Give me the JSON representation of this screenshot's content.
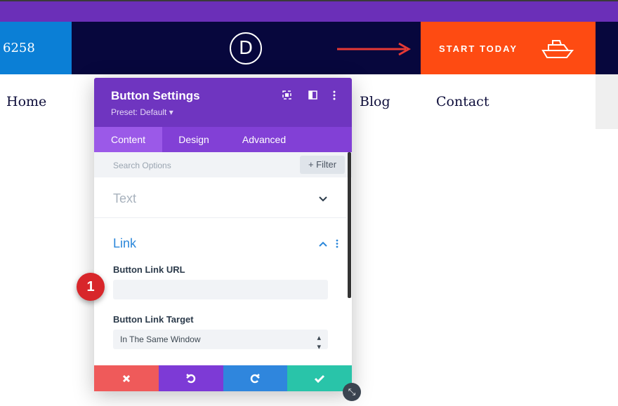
{
  "header": {
    "phone_partial": "6258",
    "logo_letter": "D",
    "cta_label": "START TODAY",
    "cta_icon": "boat-icon",
    "colors": {
      "top_strip": "#6b2fb8",
      "header": "#07073d",
      "phone_box": "#0b7fd6",
      "cta": "#fe4b12",
      "arrow": "#e53935"
    }
  },
  "nav": {
    "items": [
      "Home",
      "Blog",
      "Contact"
    ]
  },
  "modal": {
    "title": "Button Settings",
    "preset": "Preset: Default ▾",
    "header_icons": [
      "fullscreen-icon",
      "sidebar-icon",
      "more-icon"
    ],
    "tabs": [
      "Content",
      "Design",
      "Advanced"
    ],
    "active_tab": "Content",
    "search_placeholder": "Search Options",
    "filter_label": "+ Filter",
    "sections": {
      "text_title": "Text",
      "link_title": "Link"
    },
    "fields": {
      "url_label": "Button Link URL",
      "url_value": "",
      "target_label": "Button Link Target",
      "target_value": "In The Same Window"
    },
    "footer_buttons": [
      "cancel-icon",
      "undo-icon",
      "redo-icon",
      "save-icon"
    ],
    "colors": {
      "head": "#6f35c0",
      "tabs": "#8240d6",
      "cancel": "#ef5a5a",
      "undo": "#7d3ad6",
      "redo": "#2f86dd",
      "save": "#29c4a9"
    }
  },
  "callout": {
    "number": "1"
  }
}
